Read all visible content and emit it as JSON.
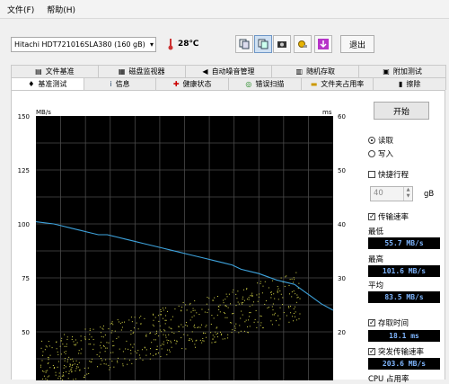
{
  "menu": [
    "文件(F)",
    "帮助(H)"
  ],
  "toolbar": {
    "drive": "Hitachi HDT721016SLA380 (160 gB)",
    "temperature": "28℃",
    "exit_label": "退出"
  },
  "tabs_top": [
    "文件基准",
    "磁盘监视器",
    "自动噪音管理",
    "随机存取",
    "附加测试"
  ],
  "tabs_bottom": [
    "基准测试",
    "信息",
    "健康状态",
    "错误扫描",
    "文件夹占用率",
    "擦除"
  ],
  "panel": {
    "start_label": "开始",
    "read_label": "读取",
    "write_label": "写入",
    "quick_label": "快捷行程",
    "quick_value": "40",
    "quick_unit": "gB",
    "transfer_label": "传输速率",
    "min_label": "最低",
    "min_value": "55.7 MB/s",
    "max_label": "最高",
    "max_value": "101.6 MB/s",
    "avg_label": "平均",
    "avg_value": "83.5 MB/s",
    "access_label": "存取时间",
    "access_value": "18.1 ms",
    "burst_label": "突发传输速率",
    "burst_value": "203.6 MB/s",
    "cpu_label": "CPU 占用率"
  },
  "colors": {
    "line": "#3ea3dd",
    "points": "#d8d84a",
    "chart_bg": "#000000",
    "grid": "#4a4a4a",
    "value_text": "#7fb6ff"
  },
  "chart_data": {
    "type": "line",
    "y_left_unit": "MB/s",
    "y_right_unit": "ms",
    "y_left_ticks": [
      150,
      125,
      100,
      75,
      50
    ],
    "y_right_ticks": [
      60,
      50,
      40,
      30,
      20
    ],
    "ylim_left": [
      50,
      150
    ],
    "ylim_right": [
      20,
      60
    ],
    "grid": true,
    "series": [
      {
        "values": [
          [
            0,
            101
          ],
          [
            3,
            100.5
          ],
          [
            6,
            100
          ],
          [
            9,
            99
          ],
          [
            12,
            98
          ],
          [
            15,
            97
          ],
          [
            18,
            96
          ],
          [
            21,
            95
          ],
          [
            24,
            95
          ],
          [
            27,
            94
          ],
          [
            30,
            93
          ],
          [
            33,
            92
          ],
          [
            36,
            91
          ],
          [
            39,
            90
          ],
          [
            42,
            89
          ],
          [
            45,
            88
          ],
          [
            48,
            87
          ],
          [
            51,
            86
          ],
          [
            54,
            85
          ],
          [
            57,
            84
          ],
          [
            60,
            83
          ],
          [
            63,
            82
          ],
          [
            66,
            81
          ],
          [
            69,
            79
          ],
          [
            72,
            78
          ],
          [
            75,
            77
          ],
          [
            78,
            75.5
          ],
          [
            81,
            74
          ],
          [
            84,
            73
          ],
          [
            87,
            72
          ],
          [
            90,
            69
          ],
          [
            93,
            66
          ],
          [
            96,
            63
          ],
          [
            100,
            60
          ]
        ]
      }
    ],
    "access_time_ms_range": [
      14,
      27
    ]
  }
}
